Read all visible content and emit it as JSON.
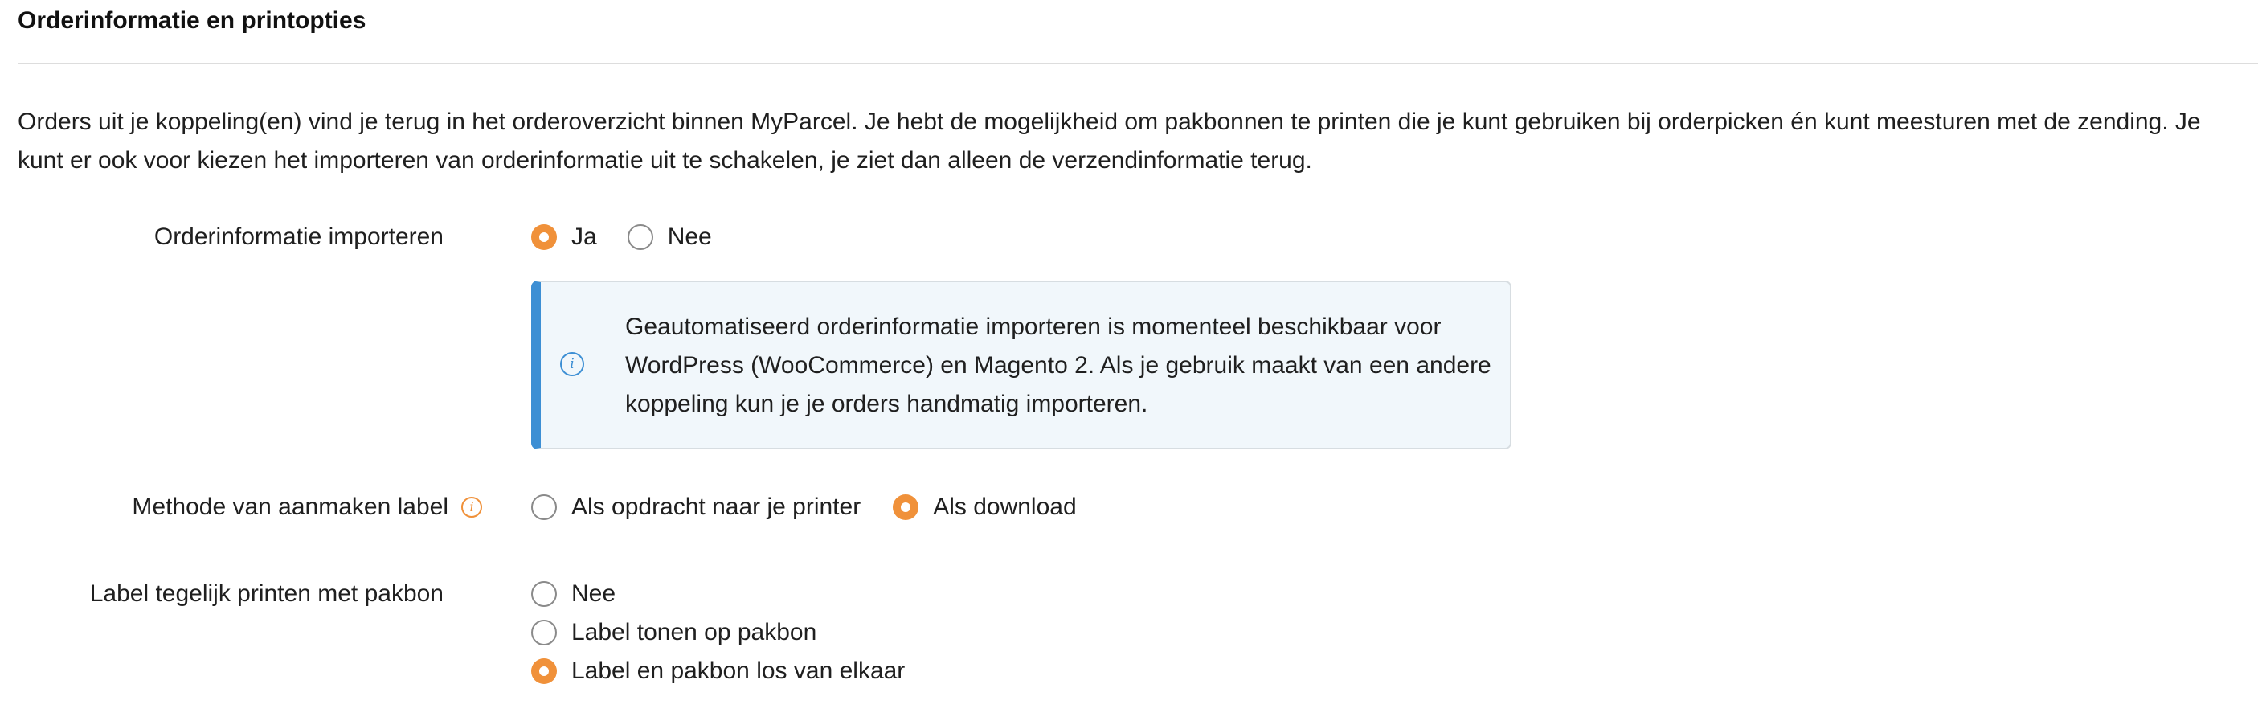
{
  "section": {
    "title": "Orderinformatie en printopties",
    "intro": "Orders uit je koppeling(en) vind je terug in het orderoverzicht binnen MyParcel. Je hebt de mogelijkheid om pakbonnen te printen die je kunt gebruiken bij orderpicken én kunt meesturen met de zending. Je kunt er ook voor kiezen het importeren van orderinformatie uit te schakelen, je ziet dan alleen de verzendinformatie terug."
  },
  "order_import": {
    "label": "Orderinformatie importeren",
    "options": [
      {
        "label": "Ja",
        "checked": true
      },
      {
        "label": "Nee",
        "checked": false
      }
    ],
    "notice": "Geautomatiseerd orderinformatie importeren is momenteel beschikbaar voor WordPress (WooCommerce) en Magento 2. Als je gebruik maakt van een andere koppeling kun je je orders handmatig importeren.",
    "notice_icon": "info-icon"
  },
  "label_method": {
    "label": "Methode van aanmaken label",
    "help_icon": "info-icon",
    "options": [
      {
        "label": "Als opdracht naar je printer",
        "checked": false
      },
      {
        "label": "Als download",
        "checked": true
      }
    ]
  },
  "print_with_packing_slip": {
    "label": "Label tegelijk printen met pakbon",
    "options": [
      {
        "label": "Nee",
        "checked": false
      },
      {
        "label": "Label tonen op pakbon",
        "checked": false
      },
      {
        "label": "Label en pakbon los van elkaar",
        "checked": true
      }
    ]
  },
  "colors": {
    "accent": "#f0913a",
    "info": "#3d8fd4",
    "notice_bg": "#f1f7fb"
  }
}
